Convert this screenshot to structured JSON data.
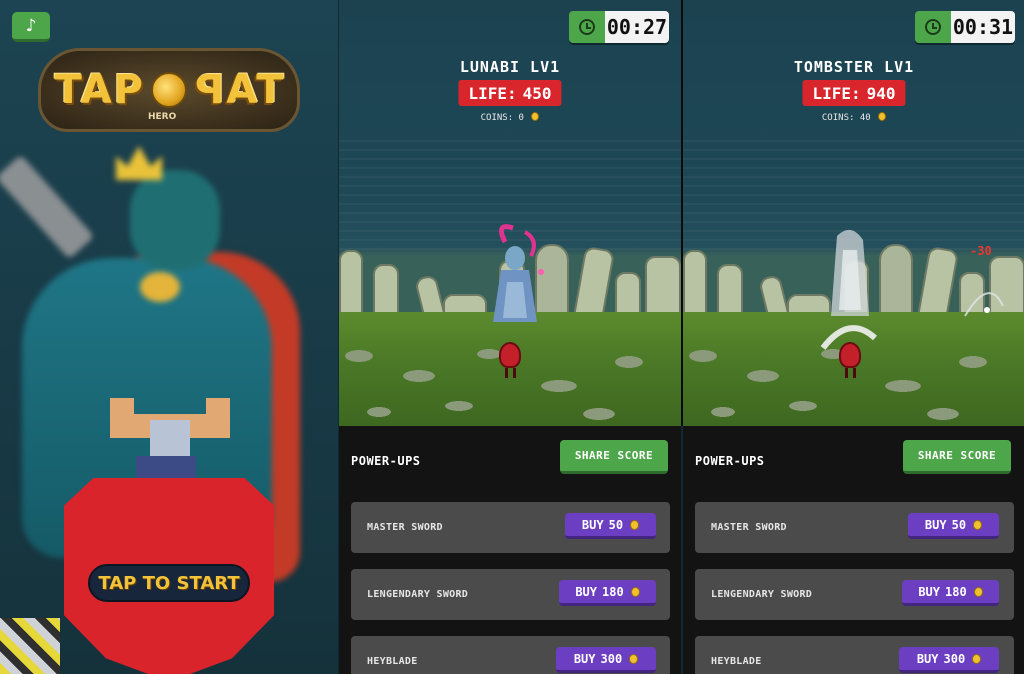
{
  "title_screen": {
    "music_icon": "music-note-icon",
    "logo_text_left": "TAP",
    "logo_text_right": "TAP",
    "logo_sub": "HERO",
    "start_label": "TAP TO START"
  },
  "panels": [
    {
      "timer": "00:27",
      "enemy_name": "LUNABI LV1",
      "life_label": "LIFE:",
      "life_value": "450",
      "coins_label": "COINS:",
      "coins_value": "0",
      "damage_text": "",
      "powerups_title": "POWER-UPS",
      "share_label": "SHARE SCORE",
      "items": [
        {
          "name": "MASTER SWORD",
          "buy_label": "BUY",
          "price": "50"
        },
        {
          "name": "LENGENDARY SWORD",
          "buy_label": "BUY",
          "price": "180"
        },
        {
          "name": "HEYBLADE",
          "buy_label": "BUY",
          "price": "300"
        }
      ]
    },
    {
      "timer": "00:31",
      "enemy_name": "TOMBSTER LV1",
      "life_label": "LIFE:",
      "life_value": "940",
      "coins_label": "COINS:",
      "coins_value": "40",
      "damage_text": "-30",
      "powerups_title": "POWER-UPS",
      "share_label": "SHARE SCORE",
      "items": [
        {
          "name": "MASTER SWORD",
          "buy_label": "BUY",
          "price": "50"
        },
        {
          "name": "LENGENDARY SWORD",
          "buy_label": "BUY",
          "price": "180"
        },
        {
          "name": "HEYBLADE",
          "buy_label": "BUY",
          "price": "300"
        }
      ]
    }
  ],
  "colors": {
    "green_button": "#4ea64a",
    "life_red": "#d8262c",
    "buy_purple": "#6c3fc2",
    "item_gray": "#4b4b4b",
    "gold": "#f2c33a"
  }
}
